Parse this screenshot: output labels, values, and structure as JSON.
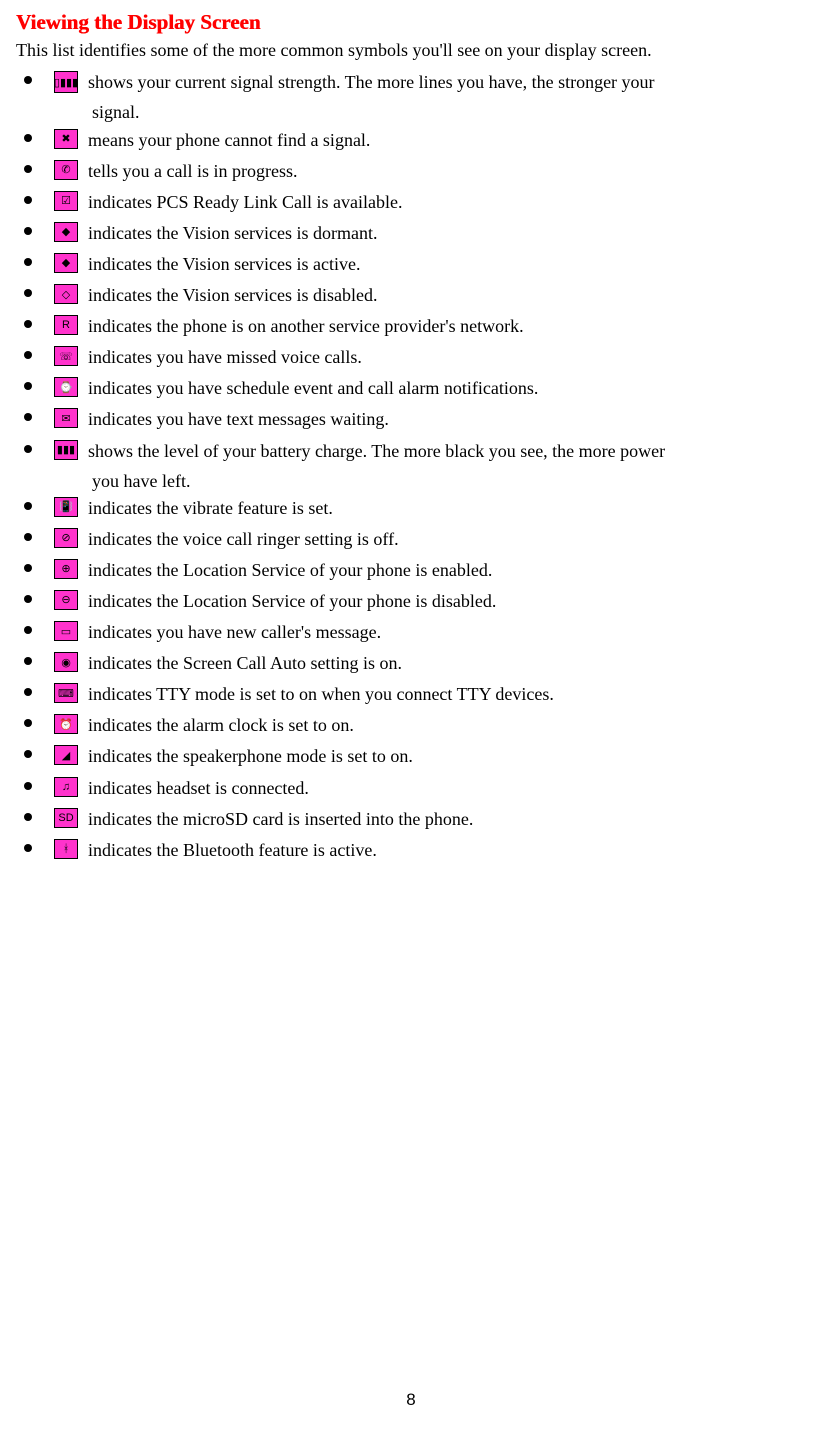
{
  "heading": "Viewing the Display Screen",
  "intro": "This list identifies some of the more common symbols you'll see on your display screen.",
  "items": [
    {
      "icon": "signal-strength-icon",
      "glyph": "▯▮▮▮",
      "text": "shows your current signal strength. The more lines you have, the stronger your",
      "cont": "signal."
    },
    {
      "icon": "no-signal-icon",
      "glyph": "✖",
      "text": "means your phone cannot find a signal."
    },
    {
      "icon": "call-in-progress-icon",
      "glyph": "✆",
      "text": "tells you a call is in progress."
    },
    {
      "icon": "ready-link-icon",
      "glyph": "☑",
      "text": "indicates PCS Ready Link Call is available."
    },
    {
      "icon": "vision-dormant-icon",
      "glyph": "◆",
      "text": "indicates the Vision services is dormant."
    },
    {
      "icon": "vision-active-icon",
      "glyph": "◆",
      "text": "indicates the Vision services is active."
    },
    {
      "icon": "vision-disabled-icon",
      "glyph": "◇",
      "text": "indicates the Vision services is disabled."
    },
    {
      "icon": "roaming-icon",
      "glyph": "R",
      "text": "indicates the phone is on another service provider's network."
    },
    {
      "icon": "missed-calls-icon",
      "glyph": "☏",
      "text": "indicates you have missed voice calls."
    },
    {
      "icon": "schedule-alarm-icon",
      "glyph": "⌚",
      "text": "indicates you have schedule event and call alarm notifications."
    },
    {
      "icon": "text-message-icon",
      "glyph": "✉",
      "text": "indicates you have text messages waiting."
    },
    {
      "icon": "battery-icon",
      "glyph": "▮▮▮",
      "text": "shows the level of your battery charge. The more black you see, the more power",
      "cont": "you have left."
    },
    {
      "icon": "vibrate-icon",
      "glyph": "📳",
      "text": "indicates the vibrate feature is set."
    },
    {
      "icon": "ringer-off-icon",
      "glyph": "⊘",
      "text": "indicates the voice call ringer setting is off."
    },
    {
      "icon": "location-enabled-icon",
      "glyph": "⊕",
      "text": "indicates the Location Service of your phone is enabled."
    },
    {
      "icon": "location-disabled-icon",
      "glyph": "⊖",
      "text": "indicates the Location Service of your phone is disabled."
    },
    {
      "icon": "caller-message-icon",
      "glyph": "▭",
      "text": "indicates you have new caller's message."
    },
    {
      "icon": "screen-call-auto-icon",
      "glyph": "◉",
      "text": "indicates the Screen Call Auto setting is on."
    },
    {
      "icon": "tty-icon",
      "glyph": "⌨",
      "text": "indicates TTY mode is set to on when you connect TTY devices."
    },
    {
      "icon": "alarm-clock-icon",
      "glyph": "⏰",
      "text": "indicates the alarm clock is set to on."
    },
    {
      "icon": "speakerphone-icon",
      "glyph": "◢",
      "text": "indicates the speakerphone mode is set to on."
    },
    {
      "icon": "headset-icon",
      "glyph": "♫",
      "text": "indicates headset is connected."
    },
    {
      "icon": "microsd-icon",
      "glyph": "SD",
      "text": "indicates the microSD card is inserted into the phone."
    },
    {
      "icon": "bluetooth-icon",
      "glyph": "ᚼ",
      "text": "indicates the Bluetooth feature is active."
    }
  ],
  "page_number": "8"
}
